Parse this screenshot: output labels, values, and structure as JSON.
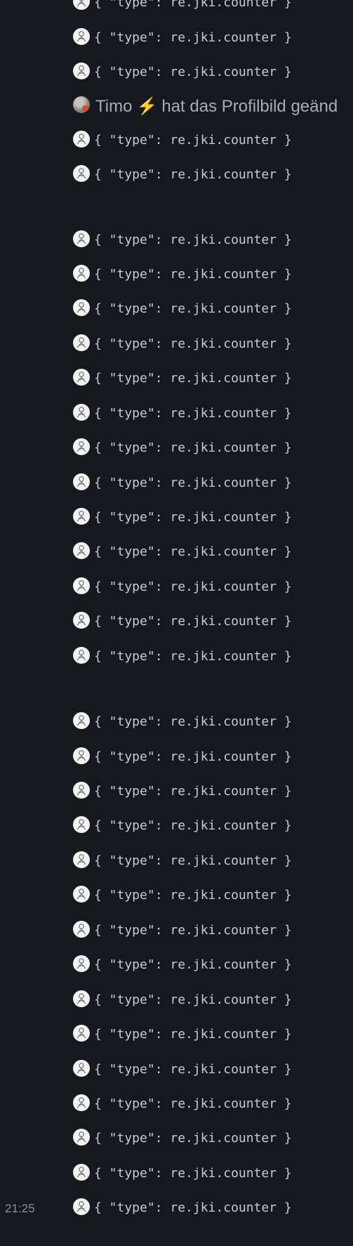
{
  "timeline": {
    "event_text": "{ \"type\": re.jki.counter }",
    "member_event": {
      "name": "Timo",
      "badge_icon": "lightning-icon",
      "action": "hat das Profilbild geänd"
    },
    "last_timestamp": "21:25",
    "avatar_icons": {
      "bot": "bot-avatar-icon",
      "user": "user-photo-avatar-icon"
    }
  }
}
